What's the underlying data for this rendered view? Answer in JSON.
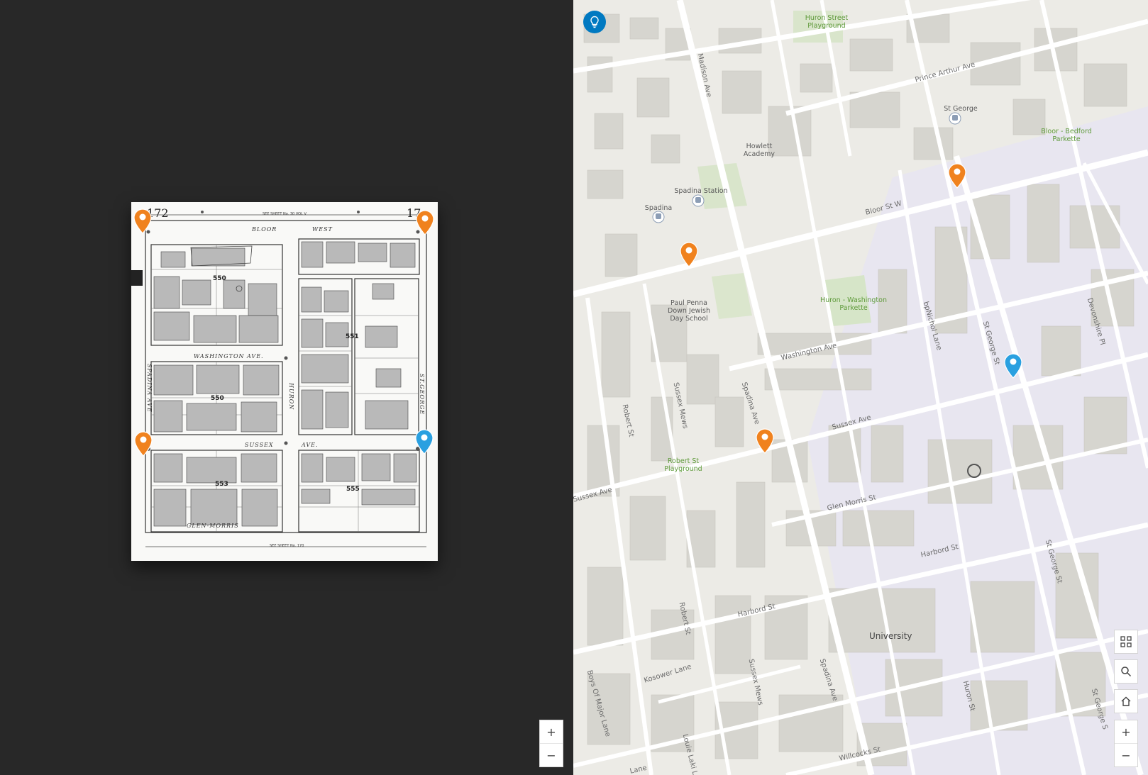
{
  "left_panel": {
    "sheet_number_left": "172",
    "sheet_number_right": "17",
    "top_note": "SEE SHEET No. 30 VOL V",
    "bottom_note": "SEE SHEET No. 170",
    "streets": {
      "bloor": "BLOOR",
      "west": "WEST",
      "washington": "WASHINGTON AVE.",
      "sussex": "SUSSEX",
      "sussex_ave": "AVE.",
      "glen_morris": "GLEN-MORRIS",
      "spadina": "SPADINA AVE",
      "huron": "HURON",
      "st_george": "ST.GEORGE"
    },
    "lot_labels": [
      "550",
      "550",
      "551",
      "553",
      "555"
    ],
    "zoom_in": "+",
    "zoom_out": "−"
  },
  "right_panel": {
    "streets": {
      "madison": "Madison Ave",
      "prince_arthur": "Prince Arthur Ave",
      "bloor": "Bloor St W",
      "washington": "Washington Ave",
      "sussex_ave": "Sussex Ave",
      "sussex_ave_w": "Sussex Ave",
      "glen_morris": "Glen Morris St",
      "harbord_e": "Harbord St",
      "harbord_w": "Harbord St",
      "spadina_n": "Spadina Ave",
      "spadina_s": "Spadina Ave",
      "robert_n": "Robert St",
      "robert_s": "Robert St",
      "sussex_mews_n": "Sussex Mews",
      "sussex_mews_s": "Sussex Mews",
      "st_george_n": "St George St",
      "st_george_s": "St George St",
      "st_george_se": "St George S",
      "huron": "Huron St",
      "bpnichol": "bpNichol Lane",
      "devonshire": "Devonshire Pl",
      "kosower": "Kosower Lane",
      "boys_of_major": "Boys Of Major Lane",
      "louie_laki": "Louie Laki Lane",
      "willcocks": "Willcocks St",
      "lane_bottom": "Lane"
    },
    "pois": {
      "huron_street_playground": "Huron Street\nPlayground",
      "st_george": "St George",
      "bloor_bedford": "Bloor - Bedford\nParkette",
      "howlett": "Howlett\nAcademy",
      "spadina_station": "Spadina Station",
      "spadina": "Spadina",
      "paul_penna": "Paul Penna\nDown Jewish\nDay School",
      "huron_washington": "Huron - Washington\nParkette",
      "robert_st_playground": "Robert St\nPlayground",
      "university": "University"
    },
    "colors": {
      "pin_orange": "#f0821e",
      "pin_blue": "#2aa0e0",
      "tip_button": "#0079c1",
      "campus": "#e8e6f0"
    },
    "icons": [
      "lightbulb-icon",
      "qr-code-icon",
      "search-icon",
      "home-icon",
      "plus-icon",
      "minus-icon"
    ],
    "zoom_in": "+",
    "zoom_out": "−"
  }
}
